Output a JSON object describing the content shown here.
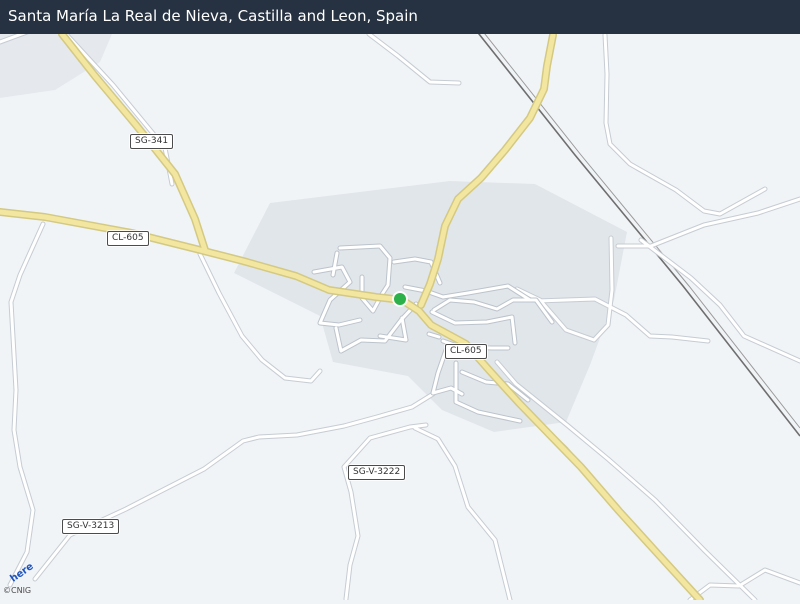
{
  "header": {
    "title": "Santa María La Real de Nieva, Castilla and Leon, Spain"
  },
  "map": {
    "road_labels": [
      {
        "text": "SG-341"
      },
      {
        "text": "CL-605"
      },
      {
        "text": "CL-605"
      },
      {
        "text": "SG-V-3222"
      },
      {
        "text": "SG-V-3213"
      }
    ],
    "marker_color": "#2cb14a",
    "background_color": "#f1f4f7",
    "urban_area_color": "#e3e7ec",
    "road_color": "#f4e7a1",
    "minor_road_color": "#ffffff",
    "rail_color": "#6b6b6b"
  },
  "logo": {
    "text": "here",
    "icon": "here-logo-icon"
  },
  "attribution": {
    "text": "©CNIG"
  }
}
